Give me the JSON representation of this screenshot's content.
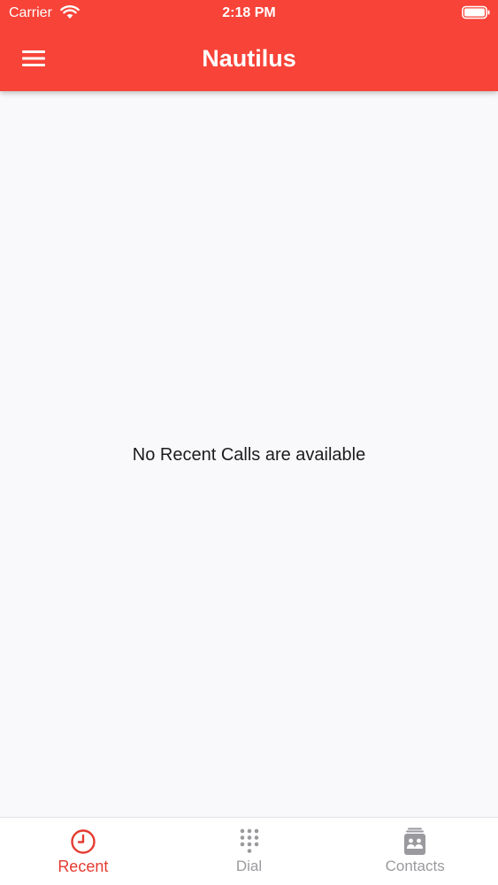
{
  "status_bar": {
    "carrier": "Carrier",
    "time": "2:18 PM"
  },
  "header": {
    "title": "Nautilus",
    "menu_icon": "hamburger-menu-icon"
  },
  "content": {
    "empty_message": "No Recent Calls are available"
  },
  "tabs": [
    {
      "label": "Recent",
      "icon": "clock-icon",
      "active": true
    },
    {
      "label": "Dial",
      "icon": "dialpad-icon",
      "active": false
    },
    {
      "label": "Contacts",
      "icon": "contacts-icon",
      "active": false
    }
  ],
  "colors": {
    "primary": "#f84338",
    "active_tab": "#e53b30",
    "inactive_tab": "#9a9a9e",
    "background": "#f9f9fb"
  }
}
